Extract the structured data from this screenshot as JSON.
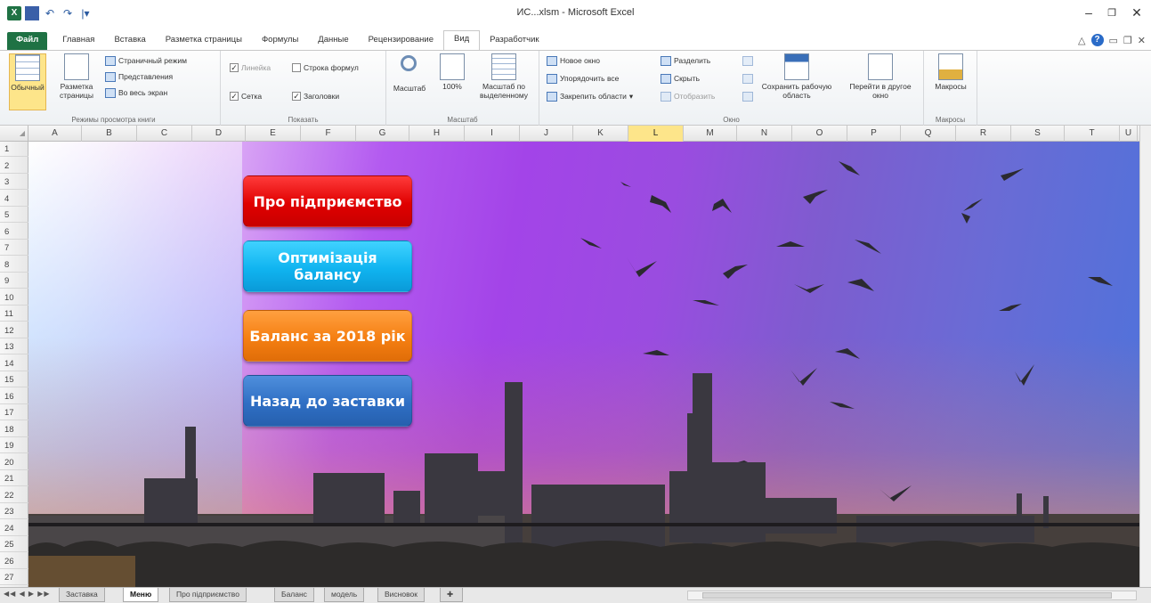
{
  "window": {
    "title": "ИС...xlsm - Microsoft Excel",
    "minimize": "–",
    "restore": "❐",
    "close": "✕"
  },
  "qat": {
    "logo": "X",
    "undo": "↶",
    "redo": "↷",
    "more": "|▾"
  },
  "tabs": [
    {
      "label": "Файл"
    },
    {
      "label": "Главная"
    },
    {
      "label": "Вставка"
    },
    {
      "label": "Разметка страницы"
    },
    {
      "label": "Формулы"
    },
    {
      "label": "Данные"
    },
    {
      "label": "Рецензирование"
    },
    {
      "label": "Вид"
    },
    {
      "label": "Разработчик"
    }
  ],
  "ribbon": {
    "views": {
      "normal": "Обычный",
      "page_layout": "Разметка страницы",
      "page_break": "Страничный режим",
      "custom_views": "Представления",
      "full_screen": "Во весь экран",
      "group_label": "Режимы просмотра книги"
    },
    "show": {
      "ruler": "Линейка",
      "formula_bar": "Строка формул",
      "gridlines": "Сетка",
      "headings": "Заголовки",
      "group_label": "Показать"
    },
    "zoom": {
      "zoom": "Масштаб",
      "hundred": "100%",
      "zoom_selection": "Масштаб по выделенному",
      "group_label": "Масштаб"
    },
    "window": {
      "new_window": "Новое окно",
      "arrange_all": "Упорядочить все",
      "freeze_panes": "Закрепить области",
      "split": "Разделить",
      "hide": "Скрыть",
      "unhide": "Отобразить",
      "save_workspace": "Сохранить рабочую область",
      "switch_windows": "Перейти в другое окно",
      "group_label": "Окно"
    },
    "macros": {
      "macros": "Макросы",
      "group_label": "Макросы"
    }
  },
  "columns": [
    "A",
    "B",
    "C",
    "D",
    "E",
    "F",
    "G",
    "H",
    "I",
    "J",
    "K",
    "L",
    "M",
    "N",
    "O",
    "P",
    "Q",
    "R",
    "S",
    "T",
    "U"
  ],
  "selected_column": "L",
  "rows": [
    "1",
    "2",
    "3",
    "4",
    "5",
    "6",
    "7",
    "8",
    "9",
    "10",
    "11",
    "12",
    "13",
    "14",
    "15",
    "16",
    "17",
    "18",
    "19",
    "20",
    "21",
    "22",
    "23",
    "24",
    "25",
    "26",
    "27"
  ],
  "menu_buttons": {
    "about": "Про підприємство",
    "optimization": "Оптимізація балансу",
    "balance": "Баланс за 2018 рік",
    "back": "Назад до заставки"
  },
  "sheets": [
    {
      "label": "Заставка"
    },
    {
      "label": "Меню"
    },
    {
      "label": "Про підприємство"
    },
    {
      "label": "Баланс"
    },
    {
      "label": "модель"
    },
    {
      "label": "Висновок"
    }
  ],
  "active_sheet": "Меню",
  "colors": {
    "excel_green": "#1f7244",
    "btn_red": "#e00000",
    "btn_cyan": "#10b4f0",
    "btn_orange": "#f57f12",
    "btn_blue": "#2f6fc4"
  }
}
